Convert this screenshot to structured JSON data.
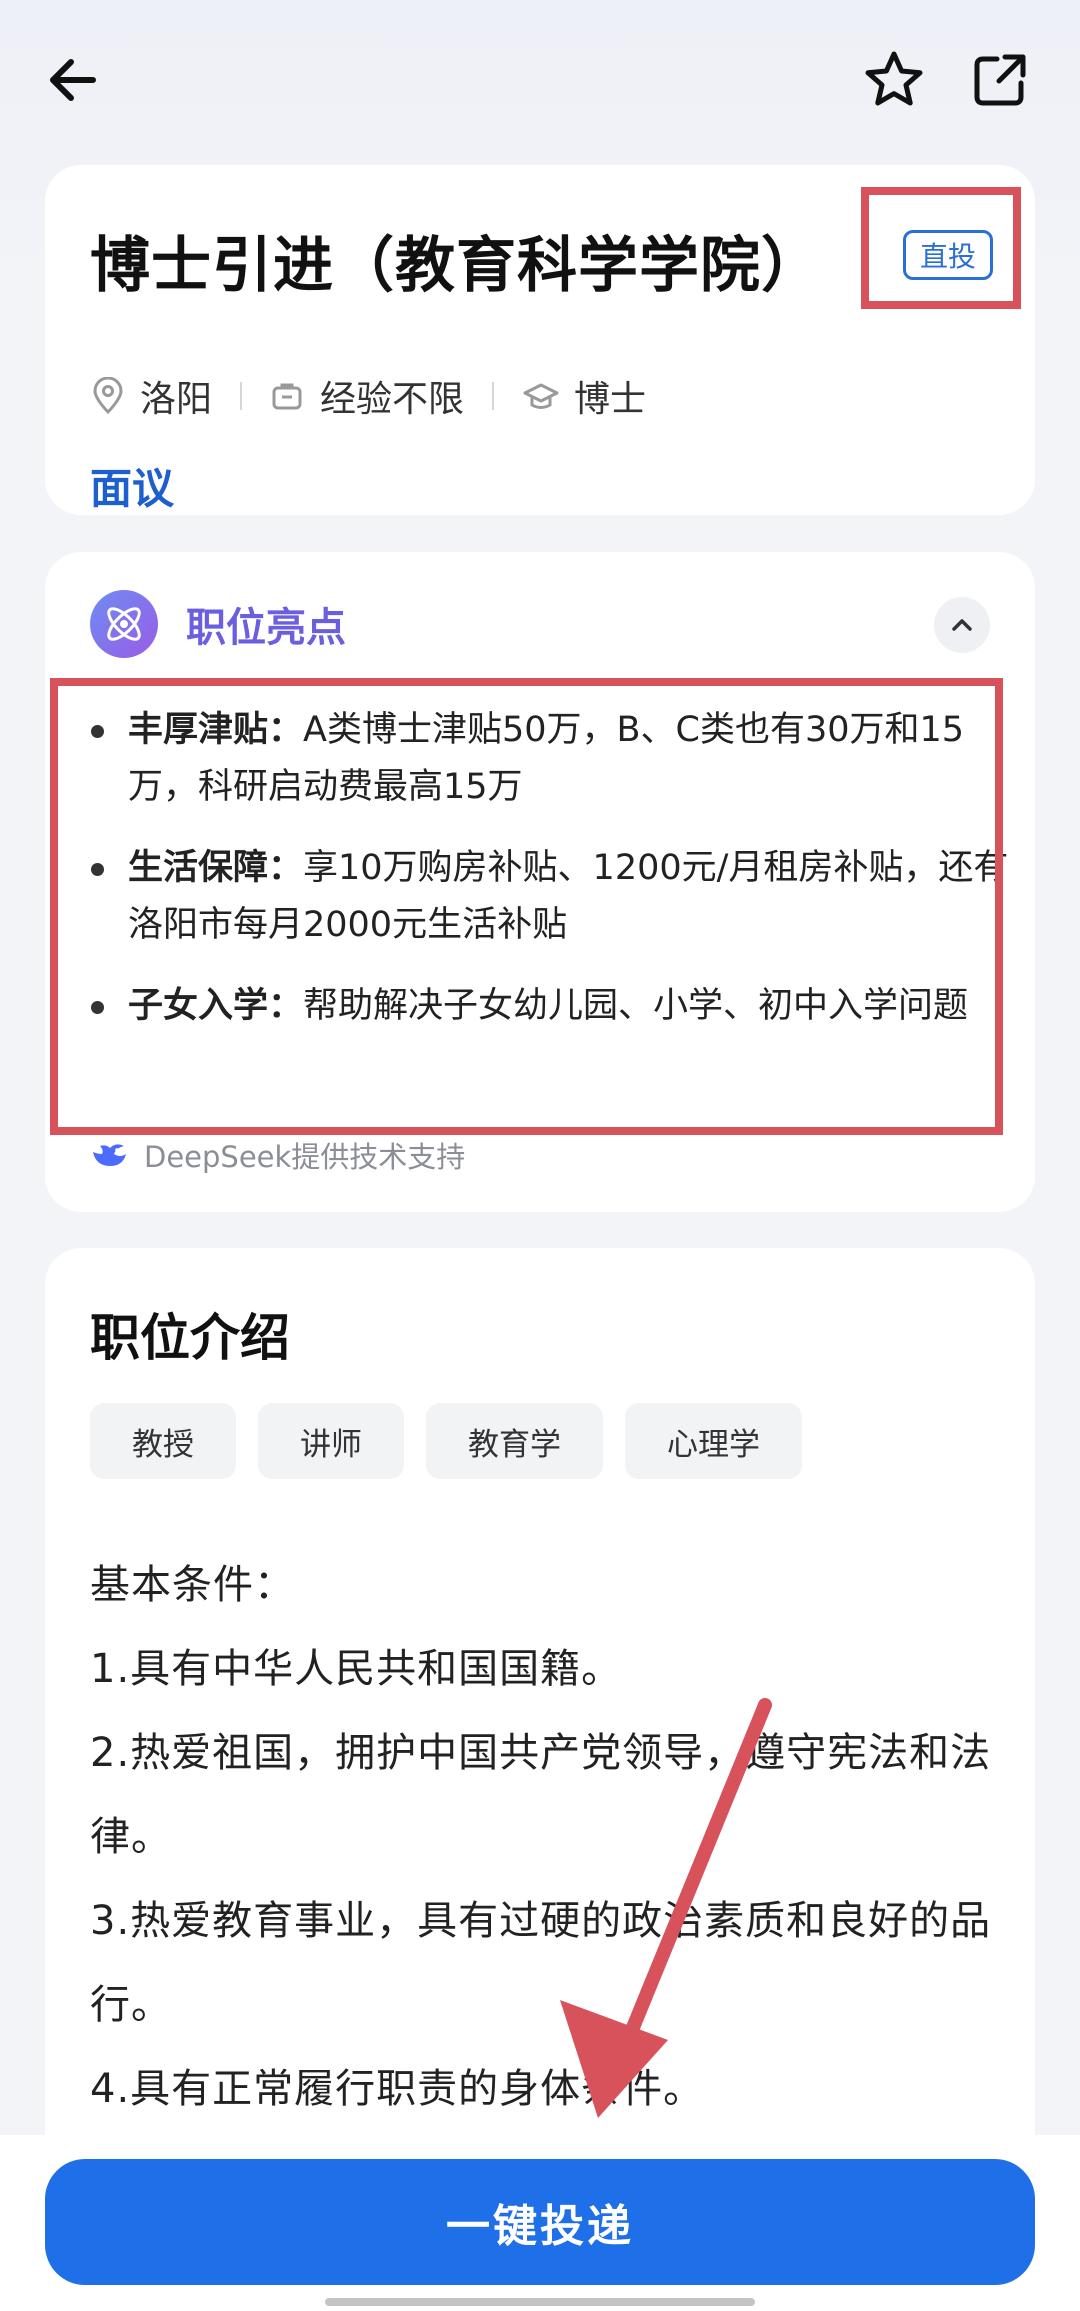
{
  "header": {
    "back_icon": "arrow-left-icon",
    "favorite_icon": "star-icon",
    "share_icon": "share-icon"
  },
  "job": {
    "title": "博士引进（教育科学学院）",
    "badge": "直投",
    "location": "洛阳",
    "experience": "经验不限",
    "education": "博士",
    "salary": "面议"
  },
  "highlights": {
    "title": "职位亮点",
    "items": [
      {
        "label": "丰厚津贴：",
        "text": "A类博士津贴50万，B、C类也有30万和15万，科研启动费最高15万"
      },
      {
        "label": "生活保障：",
        "text": "享10万购房补贴、1200元/月租房补贴，还有洛阳市每月2000元生活补贴"
      },
      {
        "label": "子女入学：",
        "text": "帮助解决子女幼儿园、小学、初中入学问题"
      }
    ],
    "powered_by": "DeepSeek提供技术支持"
  },
  "intro": {
    "title": "职位介绍",
    "tags": [
      "教授",
      "讲师",
      "教育学",
      "心理学"
    ],
    "requirements": [
      "基本条件：",
      "1.具有中华人民共和国国籍。",
      "2.热爱祖国，拥护中国共产党领导，遵守宪法和法律。",
      "3.热爱教育事业，具有过硬的政治素质和良好的品行。",
      "4.具有正常履行职责的身体条件。"
    ]
  },
  "footer": {
    "apply_label": "一键投递"
  },
  "colors": {
    "accent": "#1f6fe8",
    "highlight_purple": "#6a5fe0",
    "annotation_red": "#d8525c"
  }
}
